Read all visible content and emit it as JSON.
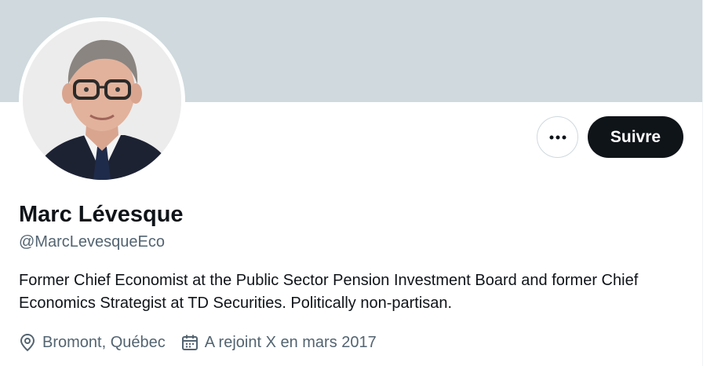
{
  "profile": {
    "display_name": "Marc Lévesque",
    "handle": "@MarcLevesqueEco",
    "bio": "Former Chief Economist at the Public Sector Pension Investment Board and former Chief Economics Strategist at TD Securities. Politically non-partisan.",
    "location": "Bromont, Québec",
    "joined": "A rejoint X en mars 2017"
  },
  "actions": {
    "follow_label": "Suivre",
    "more_icon": "more-horizontal-icon"
  },
  "colors": {
    "banner": "#cfd9de",
    "primary_text": "#0f1419",
    "secondary_text": "#536471",
    "button_dark": "#0f1419"
  }
}
